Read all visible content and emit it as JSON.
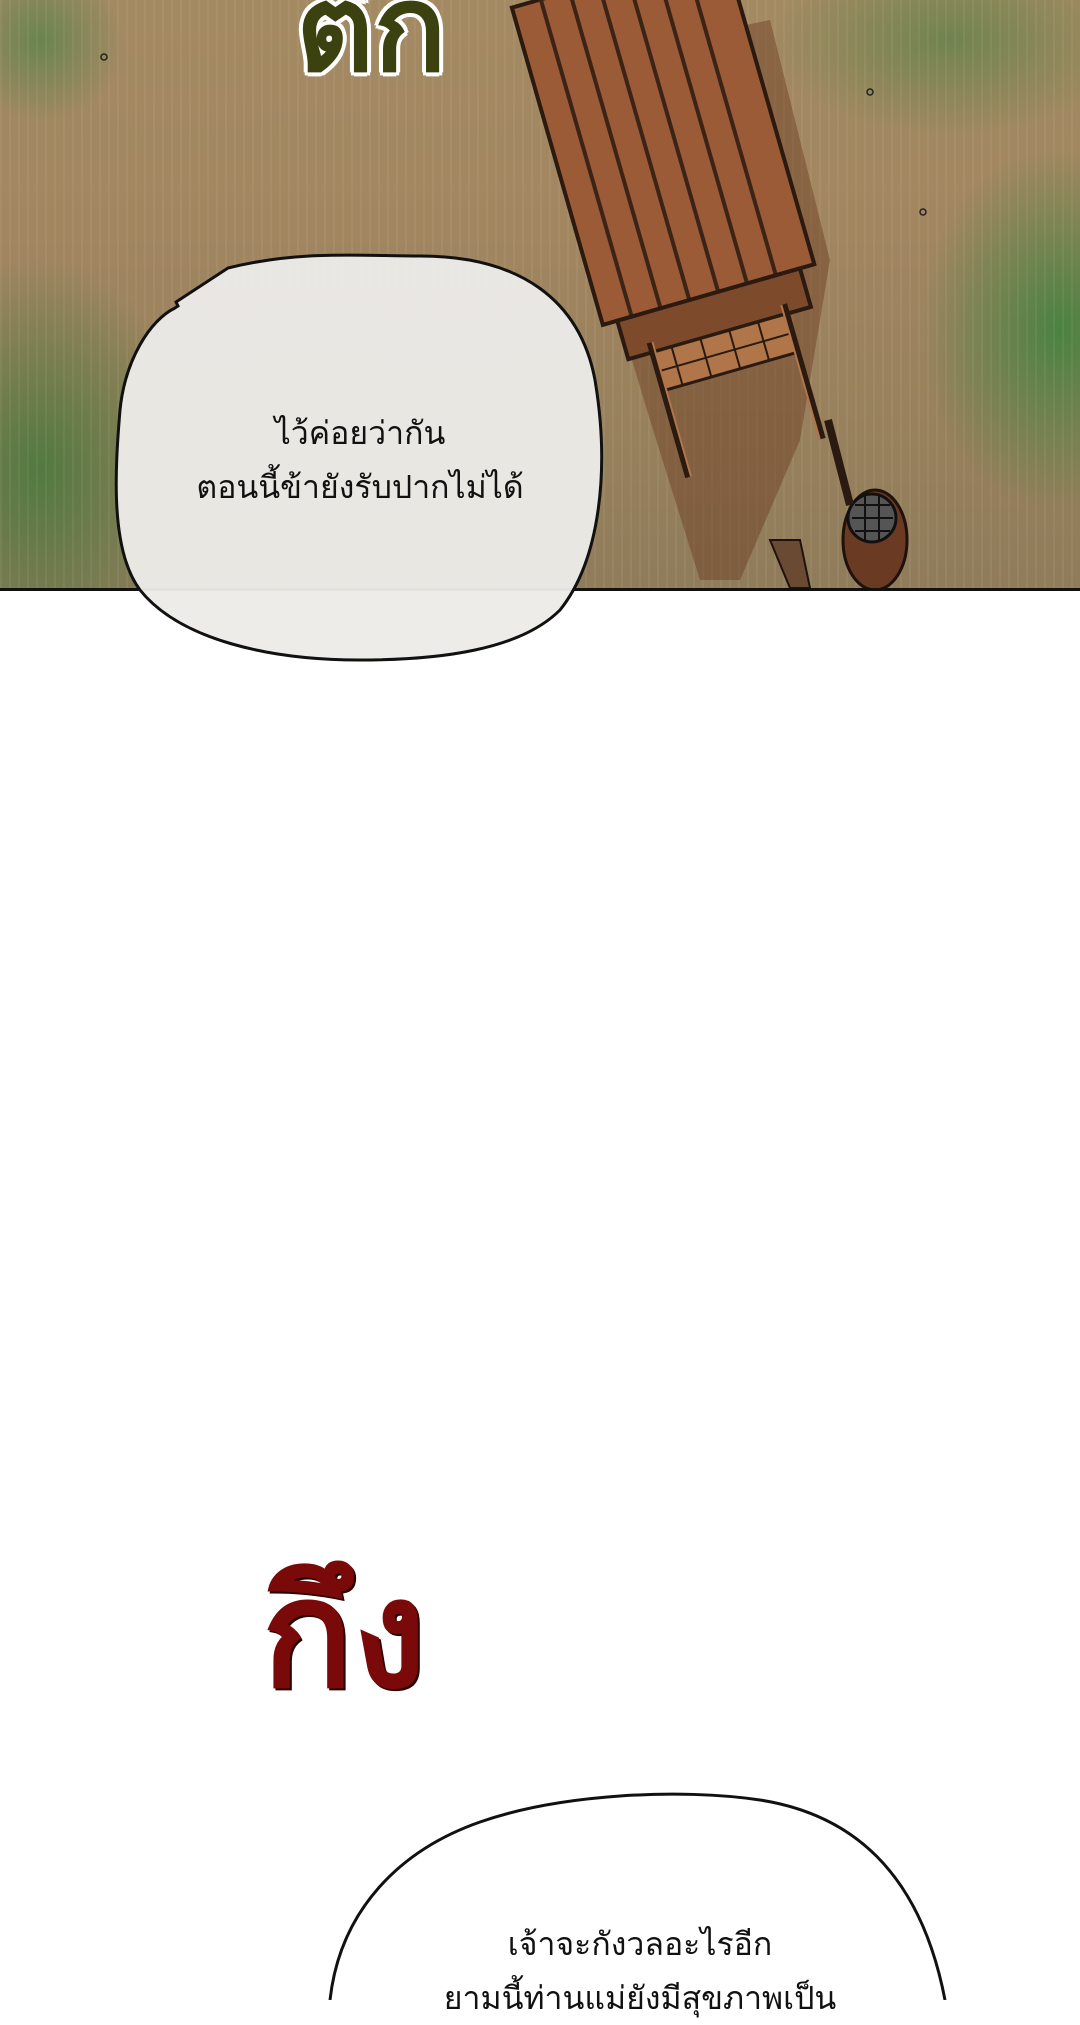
{
  "scene": {
    "sfx_top": "ตึก",
    "sfx_bottom": "กึง",
    "colors": {
      "sfx_top": "#3b4210",
      "sfx_bottom": "#7a0a0a",
      "ground": "#a18660",
      "grass": "#4d7a3c",
      "bubble_fill": "#ecebe8"
    },
    "illustration": "wooden-cart-top-view"
  },
  "bubbles": [
    {
      "lines": [
        "ไว้ค่อยว่ากัน",
        "ตอนนี้ข้ายังรับปากไม่ได้"
      ]
    },
    {
      "lines": [
        "เจ้าจะกังวลอะไรอีก",
        "ยามนี้ท่านแม่ยังมีสุขภาพเป็น"
      ]
    }
  ]
}
